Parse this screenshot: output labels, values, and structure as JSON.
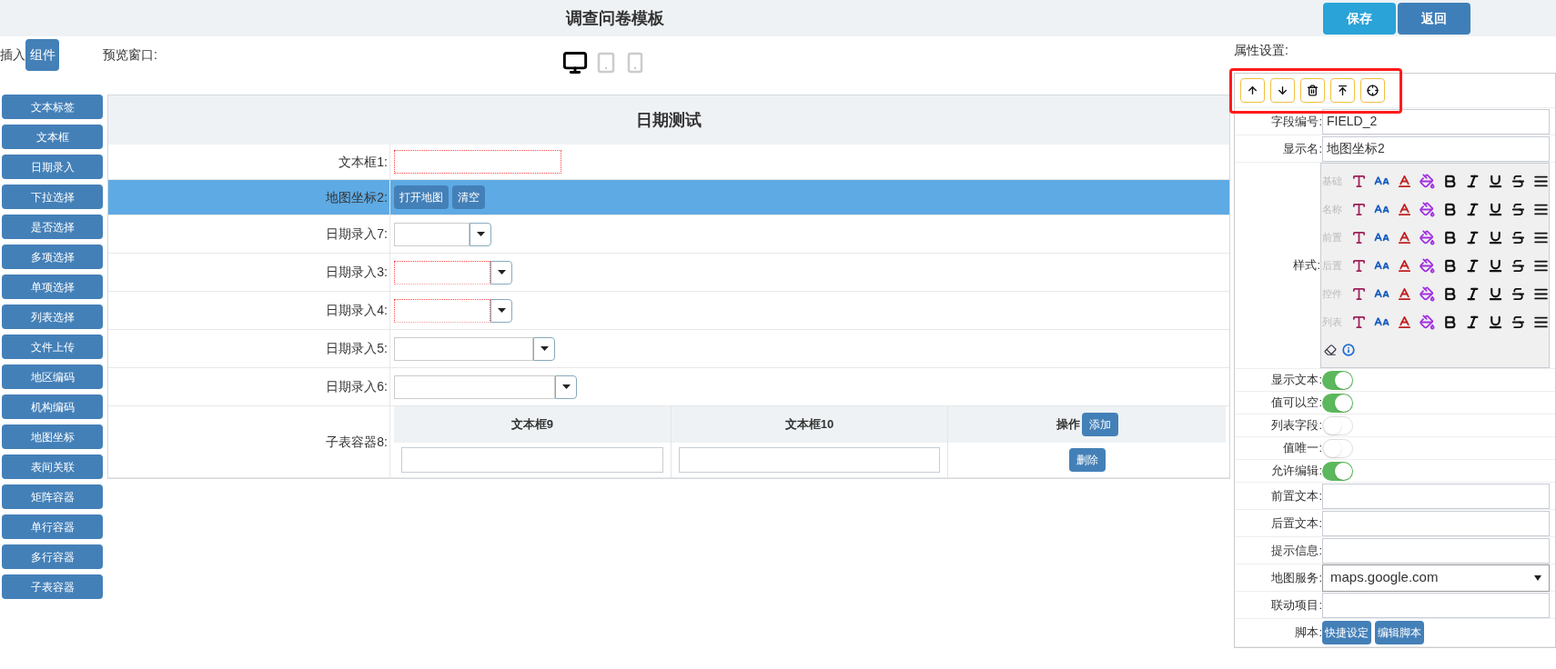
{
  "header": {
    "title": "调查问卷模板",
    "buttons": [
      {
        "label": "保存",
        "kind": "primary"
      },
      {
        "label": "返回",
        "kind": "secondary"
      }
    ]
  },
  "toolbar": {
    "insert_label": "插入",
    "insert_button": "组件",
    "preview_label": "预览窗口:",
    "devices": [
      {
        "kind": "desktop",
        "selected": true
      },
      {
        "kind": "tablet",
        "selected": false
      },
      {
        "kind": "phone",
        "selected": false
      }
    ]
  },
  "components": [
    "文本标签",
    "文本框",
    "日期录入",
    "下拉选择",
    "是否选择",
    "多项选择",
    "单项选择",
    "列表选择",
    "文件上传",
    "地区编码",
    "机构编码",
    "地图坐标",
    "表间关联",
    "矩阵容器",
    "单行容器",
    "多行容器",
    "子表容器"
  ],
  "form": {
    "title": "日期测试",
    "rows": [
      {
        "label": "文本框1:",
        "kind": "text",
        "invalid": true,
        "selected": false
      },
      {
        "label": "地图坐标2:",
        "kind": "map",
        "selected": true,
        "buttons": [
          "打开地图",
          "清空"
        ]
      },
      {
        "label": "日期录入7:",
        "kind": "date",
        "invalid": false,
        "selected": false
      },
      {
        "label": "日期录入3:",
        "kind": "date",
        "invalid": true,
        "selected": false
      },
      {
        "label": "日期录入4:",
        "kind": "date",
        "invalid": true,
        "selected": false
      },
      {
        "label": "日期录入5:",
        "kind": "date",
        "invalid": false,
        "selected": false
      },
      {
        "label": "日期录入6:",
        "kind": "date",
        "invalid": false,
        "selected": false
      },
      {
        "label": "子表容器8:",
        "kind": "subtable",
        "selected": false,
        "columns": [
          "文本框9",
          "文本框10"
        ],
        "action_header": "操作",
        "add_button": "添加",
        "delete_button": "删除"
      }
    ]
  },
  "properties": {
    "title": "属性设置:",
    "actions": [
      {
        "kind": "up"
      },
      {
        "kind": "down"
      },
      {
        "kind": "delete"
      },
      {
        "kind": "raise"
      },
      {
        "kind": "locate"
      }
    ],
    "fields": [
      {
        "label": "字段编号:",
        "kind": "input",
        "value": "FIELD_2"
      },
      {
        "label": "显示名:",
        "kind": "input",
        "value": "地图坐标2"
      },
      {
        "label": "样式:",
        "kind": "style",
        "rows": [
          "基础",
          "名称",
          "前置",
          "后置",
          "控件",
          "列表"
        ]
      },
      {
        "label": "显示文本:",
        "kind": "switch",
        "on": true
      },
      {
        "label": "值可以空:",
        "kind": "switch",
        "on": true
      },
      {
        "label": "列表字段:",
        "kind": "switch",
        "on": false
      },
      {
        "label": "值唯一:",
        "kind": "switch",
        "on": false
      },
      {
        "label": "允许编辑:",
        "kind": "switch",
        "on": true
      },
      {
        "label": "前置文本:",
        "kind": "input"
      },
      {
        "label": "后置文本:",
        "kind": "input"
      },
      {
        "label": "提示信息:",
        "kind": "input"
      },
      {
        "label": "地图服务:",
        "kind": "select",
        "value": "maps.google.com"
      },
      {
        "label": "联动项目:",
        "kind": "input"
      },
      {
        "label": "脚本:",
        "kind": "buttons",
        "buttons": [
          "快捷设定",
          "编辑脚本"
        ]
      }
    ]
  }
}
